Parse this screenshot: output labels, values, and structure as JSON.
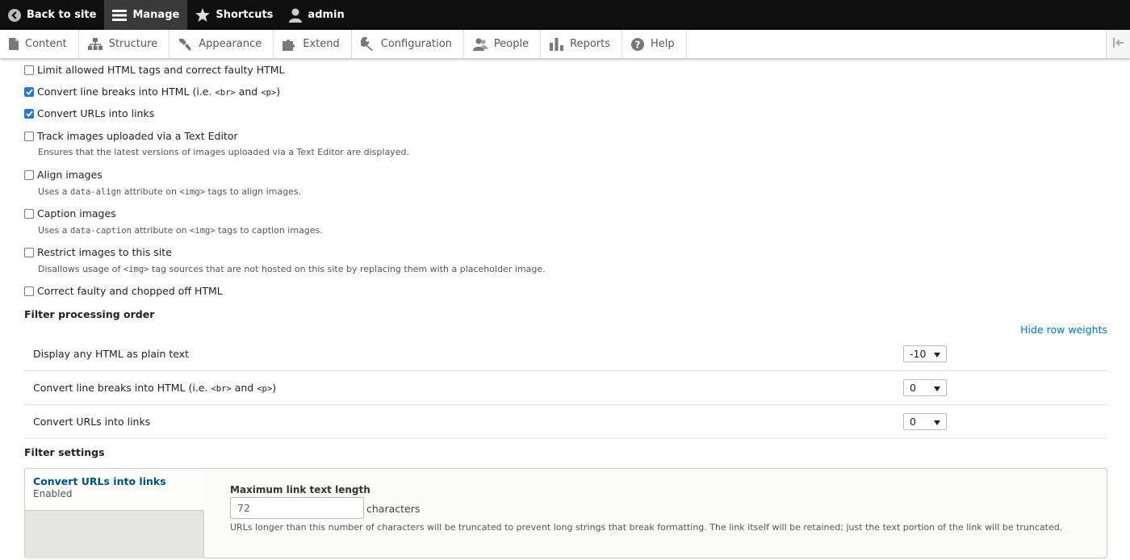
{
  "toolbar": {
    "back": "Back to site",
    "manage": "Manage",
    "shortcuts": "Shortcuts",
    "user": "admin"
  },
  "tray": {
    "items": [
      "Content",
      "Structure",
      "Appearance",
      "Extend",
      "Configuration",
      "People",
      "Reports",
      "Help"
    ]
  },
  "filters": {
    "limit_html": {
      "label": "Limit allowed HTML tags and correct faulty HTML",
      "checked": false
    },
    "line_breaks": {
      "label_pre": "Convert line breaks into HTML (i.e. ",
      "code1": "<br>",
      "mid": " and ",
      "code2": "<p>",
      "label_post": ")",
      "checked": true
    },
    "urls": {
      "label": "Convert URLs into links",
      "checked": true
    },
    "track_images": {
      "label": "Track images uploaded via a Text Editor",
      "desc": "Ensures that the latest versions of images uploaded via a Text Editor are displayed.",
      "checked": false
    },
    "align_images": {
      "label": "Align images",
      "desc_pre": "Uses a ",
      "desc_code1": "data-align",
      "desc_mid": " attribute on ",
      "desc_code2": "<img>",
      "desc_post": " tags to align images.",
      "checked": false
    },
    "caption_images": {
      "label": "Caption images",
      "desc_pre": "Uses a ",
      "desc_code1": "data-caption",
      "desc_mid": " attribute on ",
      "desc_code2": "<img>",
      "desc_post": " tags to caption images.",
      "checked": false
    },
    "restrict_images": {
      "label": "Restrict images to this site",
      "desc_pre": "Disallows usage of ",
      "desc_code": "<img>",
      "desc_post": " tag sources that are not hosted on this site by replacing them with a placeholder image.",
      "checked": false
    },
    "correct_html": {
      "label": "Correct faulty and chopped off HTML",
      "checked": false
    }
  },
  "order": {
    "title": "Filter processing order",
    "hide_weights": "Hide row weights",
    "rows": [
      {
        "label": "Display any HTML as plain text",
        "weight": "-10"
      },
      {
        "label_pre": "Convert line breaks into HTML (i.e. ",
        "code1": "<br>",
        "mid": " and ",
        "code2": "<p>",
        "label_post": ")",
        "weight": "0"
      },
      {
        "label": "Convert URLs into links",
        "weight": "0"
      }
    ]
  },
  "settings": {
    "title": "Filter settings",
    "tab_title": "Convert URLs into links",
    "tab_status": "Enabled",
    "field_label": "Maximum link text length",
    "field_value": "72",
    "field_suffix": "characters",
    "field_desc": "URLs longer than this number of characters will be truncated to prevent long strings that break formatting. The link itself will be retained; just the text portion of the link will be truncated."
  }
}
